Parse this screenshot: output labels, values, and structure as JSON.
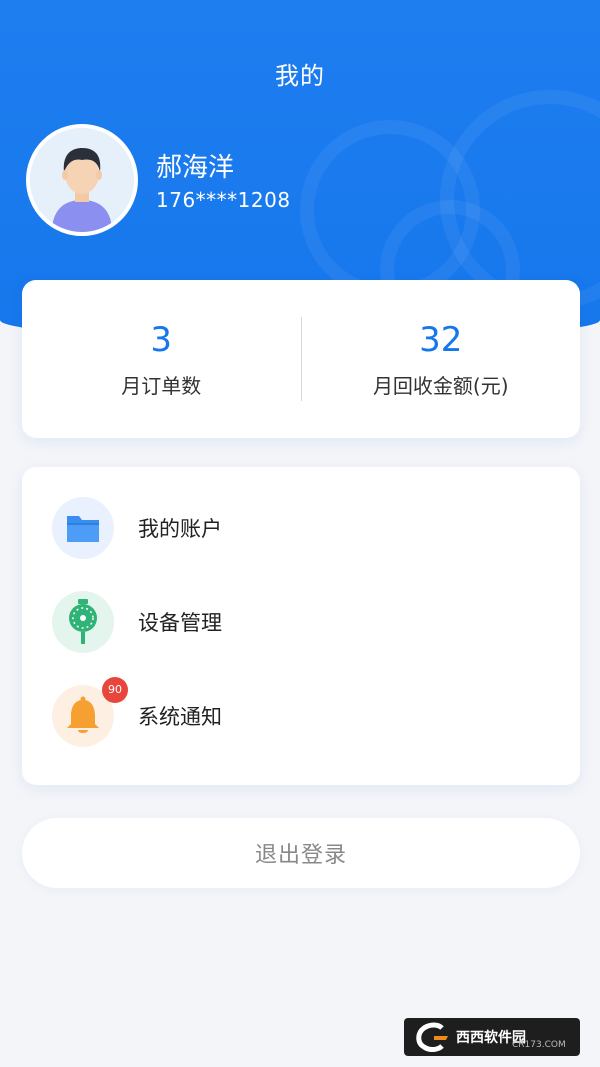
{
  "header": {
    "title": "我的"
  },
  "user": {
    "name": "郝海洋",
    "phone": "176****1208",
    "avatar_icon": "user-avatar-icon"
  },
  "stats": {
    "orders_value": "3",
    "orders_label": "月订单数",
    "amount_value": "32",
    "amount_label": "月回收金额(元)"
  },
  "menu": {
    "items": [
      {
        "label": "我的账户",
        "icon": "folder-icon",
        "color": "#3a8ef0"
      },
      {
        "label": "设备管理",
        "icon": "device-icon",
        "color": "#2fb376"
      },
      {
        "label": "系统通知",
        "icon": "bell-icon",
        "color": "#f5a030",
        "badge": "90"
      }
    ]
  },
  "logout": {
    "label": "退出登录"
  },
  "watermark": {
    "text": "西西软件园",
    "sub": "CR173.COM"
  },
  "colors": {
    "primary": "#1677ec",
    "badge": "#e8453c"
  }
}
